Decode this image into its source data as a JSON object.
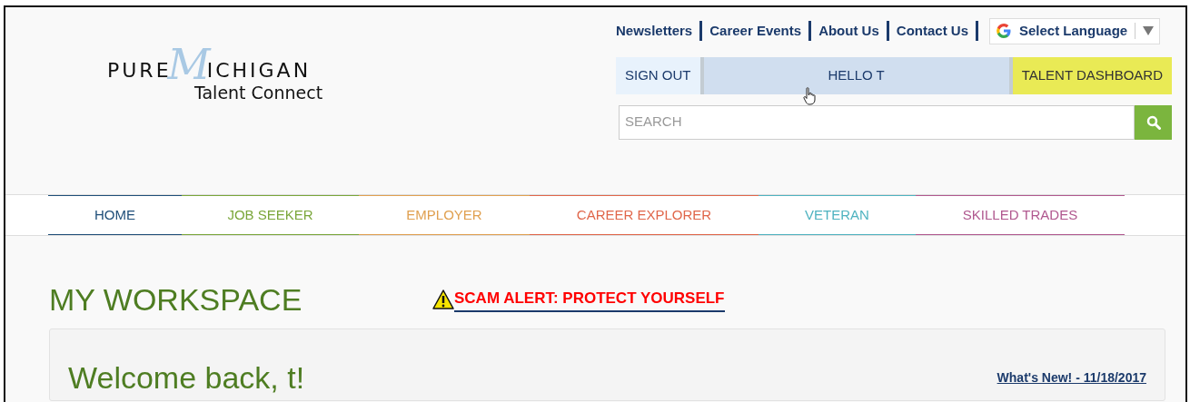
{
  "logo": {
    "word_left": "PURE",
    "script_letter": "M",
    "word_right": "ICHIGAN",
    "tagline": "Talent Connect"
  },
  "top_links": [
    "Newsletters",
    "Career Events",
    "About Us",
    "Contact Us"
  ],
  "language": {
    "label": "Select Language"
  },
  "account_bar": [
    {
      "label": "SIGN OUT",
      "kind": "plain"
    },
    {
      "label": "HELLO T",
      "kind": "hover"
    },
    {
      "label": "TALENT DASHBOARD",
      "kind": "highlight"
    }
  ],
  "search": {
    "placeholder": "SEARCH"
  },
  "nav": [
    {
      "label": "HOME",
      "color": "#1f4e79"
    },
    {
      "label": "JOB SEEKER",
      "color": "#7aa63a"
    },
    {
      "label": "EMPLOYER",
      "color": "#e0a050"
    },
    {
      "label": "CAREER EXPLORER",
      "color": "#e0664a"
    },
    {
      "label": "VETERAN",
      "color": "#4fb3c0"
    },
    {
      "label": "SKILLED TRADES",
      "color": "#b0588f"
    }
  ],
  "page_title": "MY WORKSPACE",
  "alert_link": "SCAM ALERT: PROTECT YOURSELF",
  "panel": {
    "heading": "Welcome back, t!",
    "news_link": "What's New! - 11/18/2017"
  }
}
